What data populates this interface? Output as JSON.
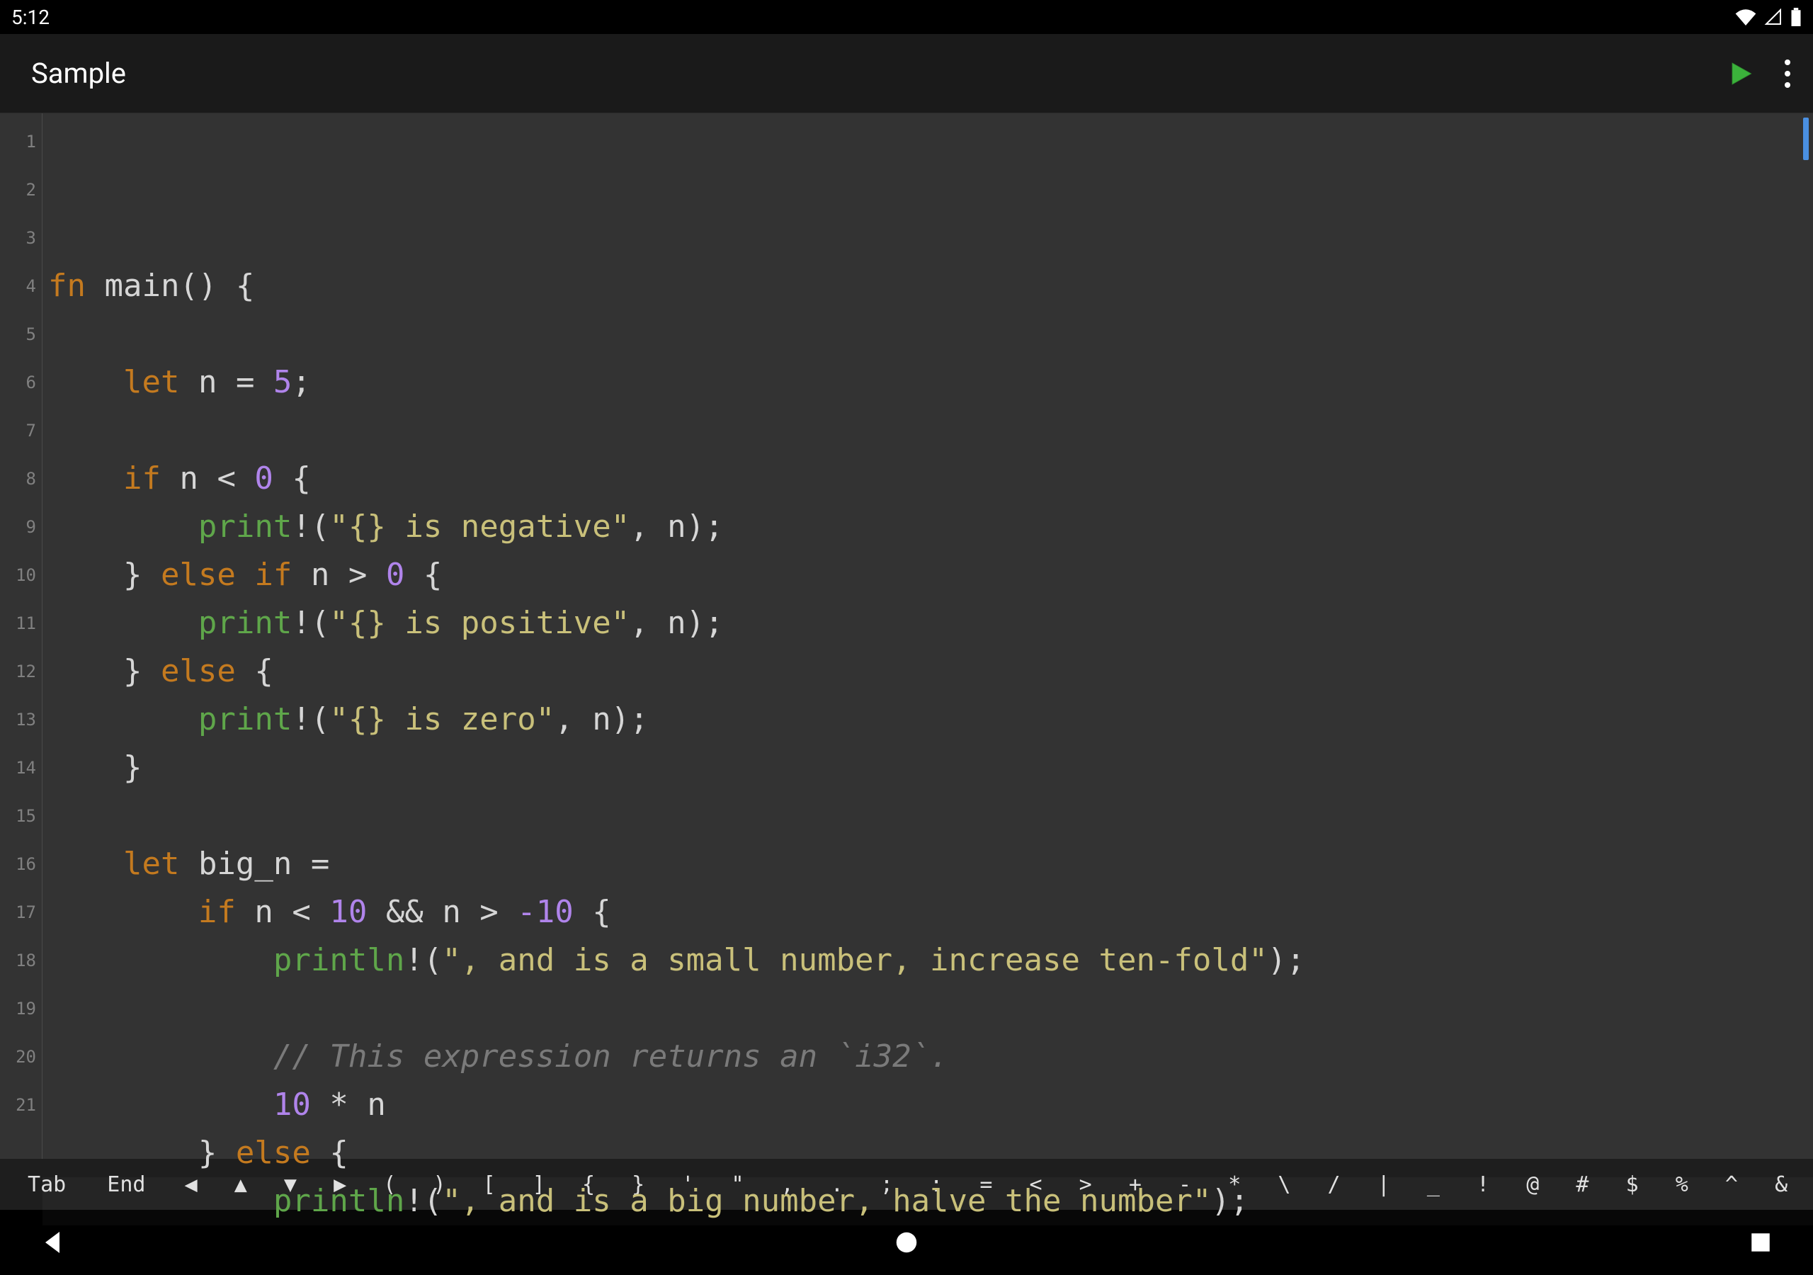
{
  "status": {
    "time": "5:12"
  },
  "app": {
    "title": "Sample"
  },
  "code": {
    "lines": [
      [
        [
          "kw",
          "fn"
        ],
        [
          "ident",
          " main"
        ],
        [
          "op",
          "()"
        ],
        [
          "op",
          " {"
        ]
      ],
      [],
      [
        [
          "op",
          "    "
        ],
        [
          "kw",
          "let"
        ],
        [
          "ident",
          " n "
        ],
        [
          "op",
          "= "
        ],
        [
          "num",
          "5"
        ],
        [
          "op",
          ";"
        ]
      ],
      [],
      [
        [
          "op",
          "    "
        ],
        [
          "kw",
          "if"
        ],
        [
          "ident",
          " n "
        ],
        [
          "op",
          "< "
        ],
        [
          "num",
          "0"
        ],
        [
          "op",
          " {"
        ]
      ],
      [
        [
          "op",
          "        "
        ],
        [
          "mac",
          "print"
        ],
        [
          "op",
          "!("
        ],
        [
          "str",
          "\"{} is negative\""
        ],
        [
          "op",
          ", n);"
        ]
      ],
      [
        [
          "op",
          "    } "
        ],
        [
          "kw",
          "else"
        ],
        [
          "op",
          " "
        ],
        [
          "kw",
          "if"
        ],
        [
          "ident",
          " n "
        ],
        [
          "op",
          "> "
        ],
        [
          "num",
          "0"
        ],
        [
          "op",
          " {"
        ]
      ],
      [
        [
          "op",
          "        "
        ],
        [
          "mac",
          "print"
        ],
        [
          "op",
          "!("
        ],
        [
          "str",
          "\"{} is positive\""
        ],
        [
          "op",
          ", n);"
        ]
      ],
      [
        [
          "op",
          "    } "
        ],
        [
          "kw",
          "else"
        ],
        [
          "op",
          " {"
        ]
      ],
      [
        [
          "op",
          "        "
        ],
        [
          "mac",
          "print"
        ],
        [
          "op",
          "!("
        ],
        [
          "str",
          "\"{} is zero\""
        ],
        [
          "op",
          ", n);"
        ]
      ],
      [
        [
          "op",
          "    }"
        ]
      ],
      [],
      [
        [
          "op",
          "    "
        ],
        [
          "kw",
          "let"
        ],
        [
          "ident",
          " big_n "
        ],
        [
          "op",
          "="
        ]
      ],
      [
        [
          "op",
          "        "
        ],
        [
          "kw",
          "if"
        ],
        [
          "ident",
          " n "
        ],
        [
          "op",
          "< "
        ],
        [
          "num",
          "10"
        ],
        [
          "op",
          " && n > "
        ],
        [
          "num",
          "-10"
        ],
        [
          "op",
          " {"
        ]
      ],
      [
        [
          "op",
          "            "
        ],
        [
          "mac",
          "println"
        ],
        [
          "op",
          "!("
        ],
        [
          "str",
          "\", and is a small number, increase ten-fold\""
        ],
        [
          "op",
          ");"
        ]
      ],
      [],
      [
        [
          "op",
          "            "
        ],
        [
          "cmt",
          "// This expression returns an `i32`."
        ]
      ],
      [
        [
          "op",
          "            "
        ],
        [
          "num",
          "10"
        ],
        [
          "op",
          " * n"
        ]
      ],
      [
        [
          "op",
          "        } "
        ],
        [
          "kw",
          "else"
        ],
        [
          "op",
          " {"
        ]
      ],
      [
        [
          "op",
          "            "
        ],
        [
          "mac",
          "println"
        ],
        [
          "op",
          "!("
        ],
        [
          "str",
          "\", and is a big number, halve the number\""
        ],
        [
          "op",
          ");"
        ]
      ],
      []
    ],
    "highlight_line": 20
  },
  "symbols": [
    "Tab",
    "End",
    "◀",
    "▲",
    "▼",
    "▶",
    "(",
    ")",
    "[",
    "]",
    "{",
    "}",
    "'",
    "\"",
    ",",
    ".",
    ";",
    ":",
    "=",
    "<",
    ">",
    "+",
    "-",
    "*",
    "\\",
    "/",
    "|",
    "_",
    "!",
    "@",
    "#",
    "$",
    "%",
    "^",
    "&"
  ]
}
